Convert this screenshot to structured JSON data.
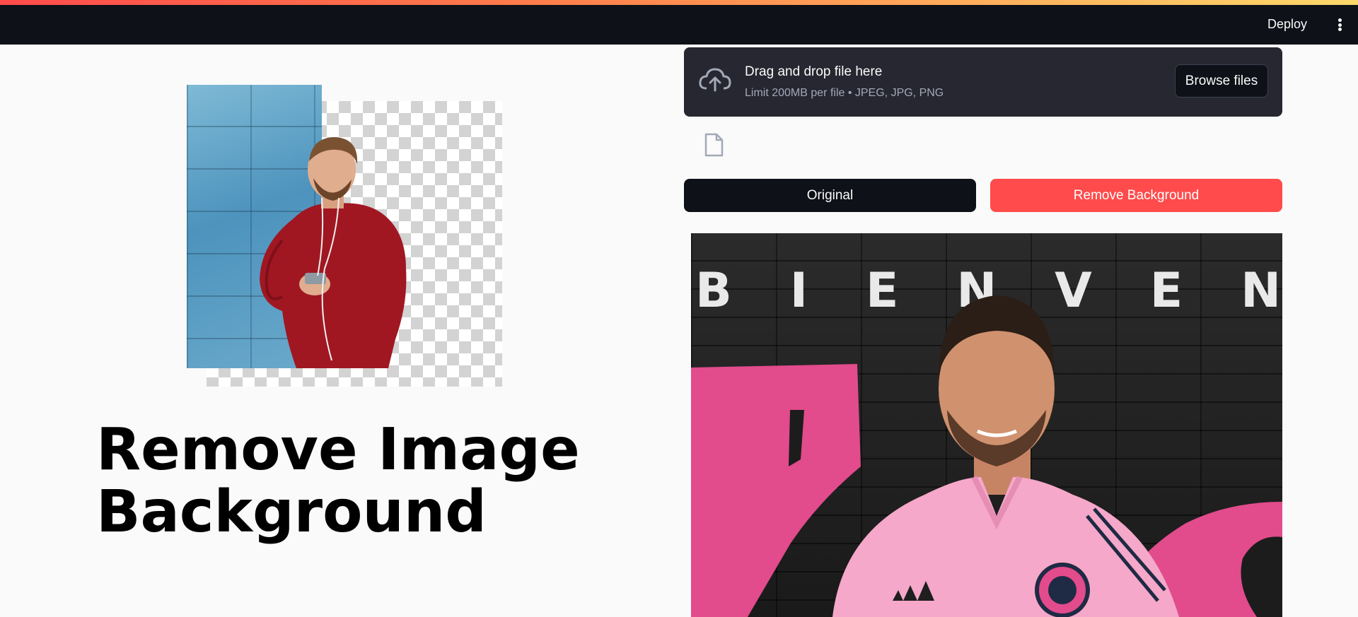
{
  "header": {
    "deploy_label": "Deploy",
    "menu_icon": "kebab-menu-icon"
  },
  "hero": {
    "title": "Remove Image Background",
    "illustration": "person-background-removal-illustration"
  },
  "uploader": {
    "title": "Drag and drop file here",
    "limit": "Limit 200MB per file • JPEG, JPG, PNG",
    "browse_label": "Browse files",
    "icon": "cloud-upload-icon"
  },
  "uploaded_file": {
    "icon": "file-icon"
  },
  "actions": {
    "original_label": "Original",
    "remove_label": "Remove Background"
  },
  "result_image": {
    "banner_letters": [
      "B",
      "I",
      "E",
      "N",
      "V",
      "E",
      "N"
    ]
  },
  "colors": {
    "header_bg": "#0e1117",
    "accent": "#ff4b4b",
    "uploader_bg": "#262730",
    "page_bg": "#fafafa"
  }
}
